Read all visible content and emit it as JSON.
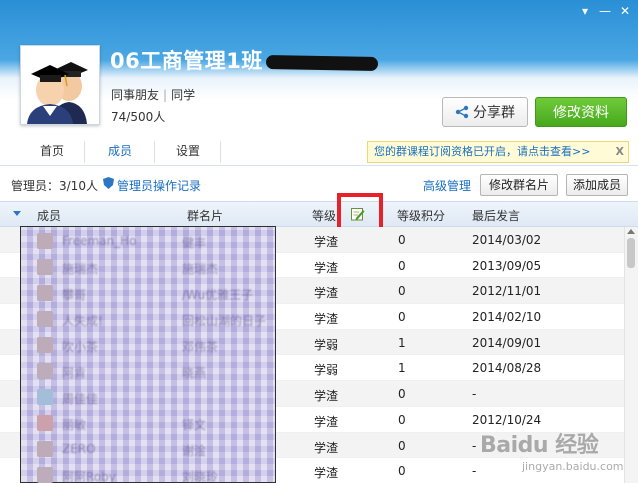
{
  "header": {
    "group_name": "06工商管理1班",
    "tag1": "同事朋友",
    "tag2": "同学",
    "member_count": "74/500人",
    "share_button": "分享群",
    "edit_button": "修改资料"
  },
  "tabs": [
    {
      "label": "首页"
    },
    {
      "label": "成员"
    },
    {
      "label": "设置"
    }
  ],
  "notice": {
    "text": "您的群课程订阅资格已开启，请点击查看>>",
    "close": "X"
  },
  "admin_bar": {
    "admin_count": "管理员：3/10人",
    "admin_log_link": "管理员操作记录",
    "advanced_link": "高级管理",
    "edit_card_button": "修改群名片",
    "add_member_button": "添加成员"
  },
  "table": {
    "columns": [
      "成员",
      "群名片",
      "等级",
      "等级积分",
      "最后发言"
    ],
    "rows": [
      {
        "member": "Freeman_Ho",
        "card": "健丰",
        "level": "学渣",
        "points": "0",
        "last": "2014/03/02"
      },
      {
        "member": "施瑞杰",
        "card": "施瑞杰",
        "level": "学渣",
        "points": "0",
        "last": "2013/09/05"
      },
      {
        "member": "攀哥",
        "card": "/Wu优雅王子",
        "level": "学渣",
        "points": "0",
        "last": "2012/11/01"
      },
      {
        "member": "人失成!",
        "card": "回松山湖的日子",
        "level": "学渣",
        "points": "0",
        "last": "2014/02/10"
      },
      {
        "member": "吹小茶",
        "card": "邓伟茶",
        "level": "学弱",
        "points": "1",
        "last": "2014/09/01"
      },
      {
        "member": "阿肯",
        "card": "晓燕",
        "level": "学弱",
        "points": "1",
        "last": "2014/08/28"
      },
      {
        "member": "周佳佳",
        "card": "",
        "level": "学渣",
        "points": "0",
        "last": "-"
      },
      {
        "member": "丽敏",
        "card": "铎文",
        "level": "学渣",
        "points": "0",
        "last": "2012/10/24"
      },
      {
        "member": "ZERO",
        "card": "谢淦",
        "level": "学渣",
        "points": "0",
        "last": "-"
      },
      {
        "member": "阿阿Roby",
        "card": "刘晓玲",
        "level": "学渣",
        "points": "0",
        "last": "-"
      }
    ]
  },
  "watermark": {
    "main": "Baidu 经验",
    "sub": "jingyan.baidu.com"
  },
  "colors": {
    "accent_blue": "#1a6fc1",
    "green_button": "#47a81d",
    "highlight_red": "#e8202a",
    "mosaic": "#c9c3e6"
  }
}
